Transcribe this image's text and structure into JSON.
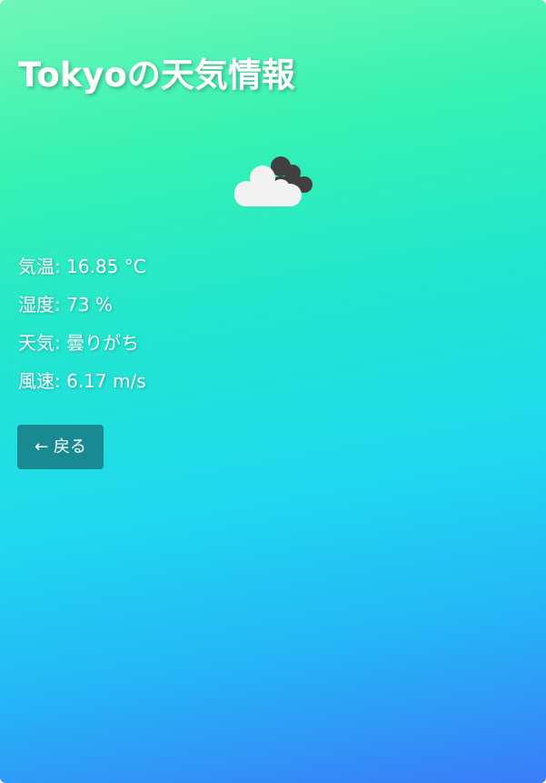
{
  "page": {
    "city": "Tokyo",
    "title": "Tokyoの天気情報"
  },
  "weather_icon": {
    "icon": "broken-clouds-icon",
    "front_cloud_color": "#f2f2f2",
    "back_cloud_color": "#404040"
  },
  "details": [
    {
      "label": "気温",
      "value": "16.85",
      "unit": "°C",
      "text": "気温: 16.85 °C"
    },
    {
      "label": "湿度",
      "value": "73",
      "unit": "%",
      "text": "湿度: 73 %"
    },
    {
      "label": "天気",
      "value": "曇りがち",
      "unit": "",
      "text": "天気: 曇りがち"
    },
    {
      "label": "風速",
      "value": "6.17",
      "unit": "m/s",
      "text": "風速: 6.17 m/s"
    }
  ],
  "back_button": {
    "label": "← 戻る",
    "color": "#198a91"
  },
  "colors": {
    "gradient_top": "#6ff7b7",
    "gradient_middle": "#1fd8f0",
    "gradient_bottom": "#3a7cf8",
    "text": "#ffffff"
  }
}
